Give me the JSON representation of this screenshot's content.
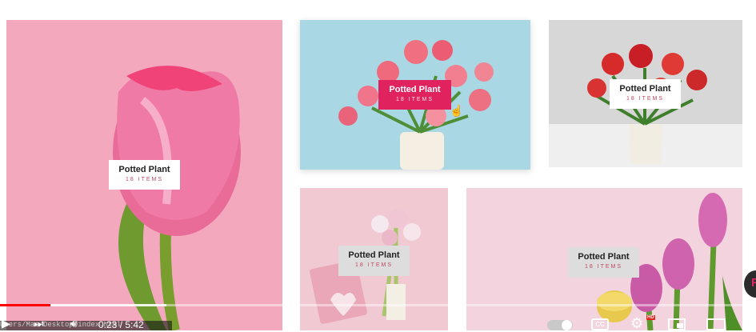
{
  "tiles": [
    {
      "title": "Potted Plant",
      "subtitle": "18 ITEMS"
    },
    {
      "title": "Potted Plant",
      "subtitle": "18 ITEMS"
    },
    {
      "title": "Potted Plant",
      "subtitle": "18 ITEMS"
    },
    {
      "title": "Potted Plant",
      "subtitle": "18 ITEMS"
    },
    {
      "title": "Potted Plant",
      "subtitle": "18 ITEMS"
    }
  ],
  "player": {
    "time": "0:23 / 5:42",
    "path": "Users/Mac/Desktop/index.html",
    "progress_fraction": 0.067,
    "buffered_fraction": 0.22,
    "hd_badge": "HD",
    "cc_label": "CC"
  },
  "colors": {
    "accent": "#e0225e",
    "progress": "#ff0000"
  }
}
